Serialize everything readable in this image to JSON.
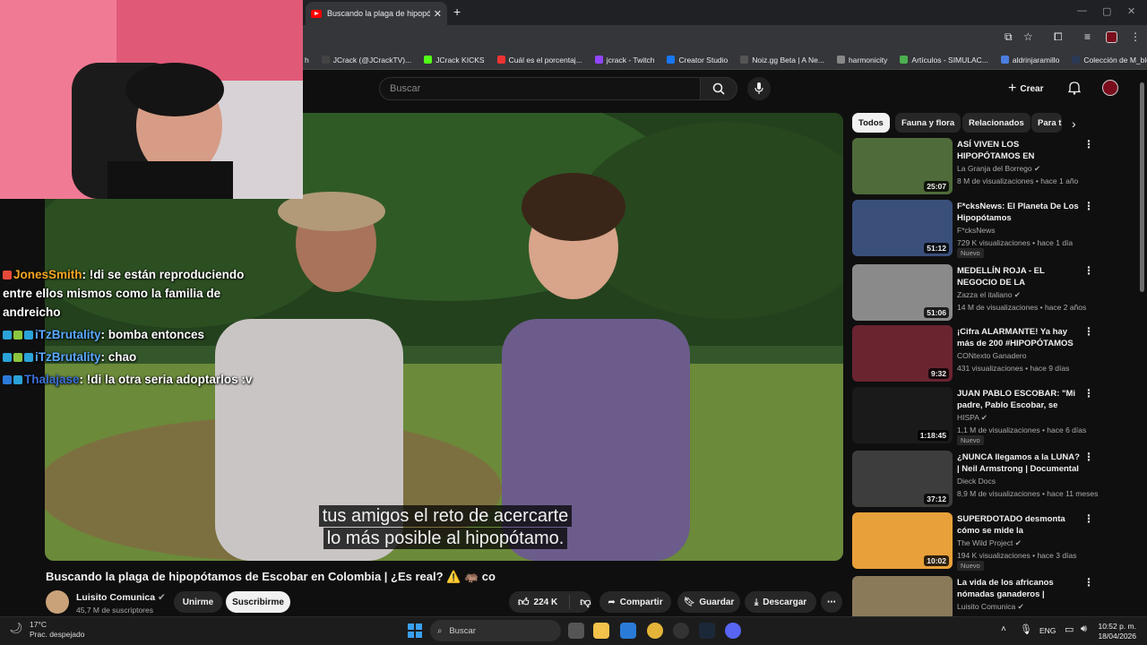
{
  "browser": {
    "tab_title": "Buscando la plaga de hipopóta",
    "close": "✕",
    "new_tab": "+",
    "bookmarks": [
      {
        "label": "h",
        "color": "#35363a"
      },
      {
        "label": "JCrack (@JCrackTV)...",
        "color": "#444"
      },
      {
        "label": "JCrack KICKS",
        "color": "#53fc18"
      },
      {
        "label": "Cuál es el porcentaj...",
        "color": "#e33"
      },
      {
        "label": "jcrack - Twitch",
        "color": "#9146ff"
      },
      {
        "label": "Creator Studio",
        "color": "#1877f2"
      },
      {
        "label": "Noiz.gg Beta | A Ne...",
        "color": "#555"
      },
      {
        "label": "harmonicity",
        "color": "#888"
      },
      {
        "label": "Artículos - SIMULAC...",
        "color": "#4caf50"
      },
      {
        "label": "aldrinjaramillo",
        "color": "#4a7de0"
      },
      {
        "label": "Colección de M_blei...",
        "color": "#2b3a55"
      }
    ]
  },
  "header": {
    "search_placeholder": "Buscar",
    "create_label": "Crear"
  },
  "video": {
    "caption_line1": "tus amigos el reto de acercarte",
    "caption_line2": "lo más posible al hipopótamo.",
    "title": "Buscando la plaga de hipopótamos de Escobar en Colombia | ¿Es real? ⚠️ 🦛 co",
    "channel": "Luisito Comunica",
    "subscribers": "45,7 M de suscriptores",
    "join_label": "Unirme",
    "subscribe_label": "Suscribirme",
    "likes": "224 K",
    "share_label": "Compartir",
    "save_label": "Guardar",
    "download_label": "Descargar"
  },
  "chat": [
    {
      "user": "JonesSmith",
      "user_color": "#f5a623",
      "message": ": !di se están reproduciendo entre ellos mismos como la familia de andreicho"
    },
    {
      "user": "iTzBrutality",
      "user_color": "#5aa9ff",
      "message": ": bomba entonces"
    },
    {
      "user": "iTzBrutality",
      "user_color": "#5aa9ff",
      "message": ": chao"
    },
    {
      "user": "Thalajase",
      "user_color": "#3b6fd6",
      "message": ": !di la otra seria adoptarlos :v"
    }
  ],
  "chips": [
    "Todos",
    "Fauna y flora",
    "Relacionados",
    "Para t"
  ],
  "recommendations": [
    {
      "title": "ASÍ VIVEN LOS HIPOPÓTAMOS EN COLOMBIA",
      "channel": "La Granja del Borrego",
      "verified": true,
      "meta": "8 M de visualizaciones • hace 1 año",
      "duration": "25:07",
      "new": false,
      "thumb": "#4f6b3a"
    },
    {
      "title": "F*cksNews: El Planeta De Los Hipopótamos",
      "channel": "F*cksNews",
      "verified": false,
      "meta": "729 K visualizaciones • hace 1 día",
      "duration": "51:12",
      "new": true,
      "thumb": "#3a4f7a"
    },
    {
      "title": "MEDELLÍN ROJA - EL NEGOCIO DE LA PROSTITUCIÓN co",
      "channel": "Zazza el italiano",
      "verified": true,
      "meta": "14 M de visualizaciones • hace 2 años",
      "duration": "51:06",
      "new": false,
      "thumb": "#8a8a8a"
    },
    {
      "title": "¡Cifra ALARMANTE! Ya hay más de 200 #HIPOPÓTAMOS ...",
      "channel": "CONtexto Ganadero",
      "verified": false,
      "meta": "431 visualizaciones • hace 9 días",
      "duration": "9:32",
      "new": false,
      "thumb": "#6a2430"
    },
    {
      "title": "JUAN PABLO ESCOBAR: \"Mi padre, Pablo Escobar, se mató;...",
      "channel": "HISPA",
      "verified": true,
      "meta": "1,1 M de visualizaciones • hace 6 días",
      "duration": "1:18:45",
      "new": true,
      "thumb": "#1a1a1a"
    },
    {
      "title": "¿NUNCA llegamos a la LUNA? | Neil Armstrong | Documental",
      "channel": "Dieck Docs",
      "verified": false,
      "meta": "8,9 M de visualizaciones • hace 11 meses",
      "duration": "37:12",
      "new": false,
      "thumb": "#3d3d3d"
    },
    {
      "title": "SUPERDOTADO desmonta cómo se mide la INTELIGENCIA",
      "channel": "The Wild Project",
      "verified": true,
      "meta": "194 K visualizaciones • hace 3 días",
      "duration": "10:02",
      "new": true,
      "thumb": "#e8a13a"
    },
    {
      "title": "La vida de los africanos nómadas ganaderos | Mundari...",
      "channel": "Luisito Comunica",
      "verified": true,
      "meta": "",
      "duration": "",
      "new": false,
      "thumb": "#8a7a5a"
    }
  ],
  "new_badge": "Nuevo",
  "taskbar": {
    "temperature": "17°C",
    "weather": "Prac. despejado",
    "search": "Buscar",
    "language": "ENG",
    "time": "10:52 p. m.",
    "date": "18/04/2026"
  }
}
